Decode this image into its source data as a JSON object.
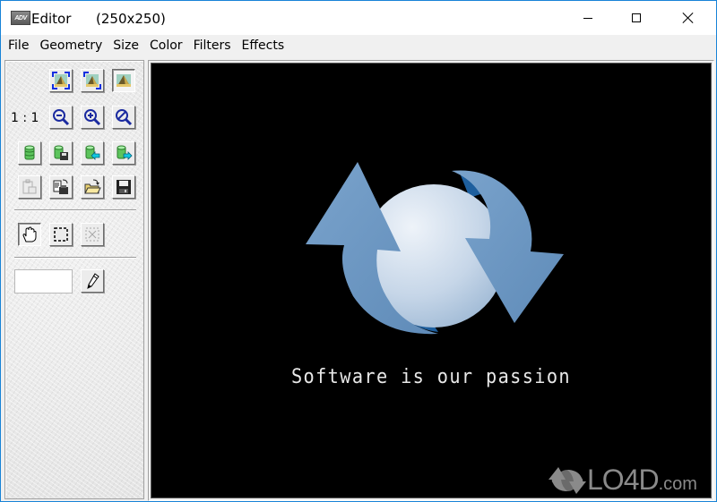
{
  "window": {
    "app_icon_label": "ADV",
    "title": "Editor",
    "image_size": "(250x250)",
    "controls": {
      "minimize": "minimize",
      "maximize": "maximize",
      "close": "close"
    }
  },
  "menubar": {
    "items": [
      {
        "label": "File"
      },
      {
        "label": "Geometry"
      },
      {
        "label": "Size"
      },
      {
        "label": "Color"
      },
      {
        "label": "Filters"
      },
      {
        "label": "Effects"
      }
    ]
  },
  "toolpanel": {
    "zoom_ratio_label": "1 : 1",
    "view_buttons": [
      {
        "icon": "fit-to-window-icon",
        "state": "normal"
      },
      {
        "icon": "fit-width-icon",
        "state": "normal"
      },
      {
        "icon": "actual-size-icon",
        "state": "pressed"
      }
    ],
    "zoom_buttons": [
      {
        "icon": "zoom-out-icon"
      },
      {
        "icon": "zoom-in-icon"
      },
      {
        "icon": "zoom-reset-icon"
      }
    ],
    "database_buttons": [
      {
        "icon": "database-icon"
      },
      {
        "icon": "database-save-icon"
      },
      {
        "icon": "database-import-icon"
      },
      {
        "icon": "database-export-icon"
      }
    ],
    "file_buttons": [
      {
        "icon": "paste-icon",
        "state": "disabled"
      },
      {
        "icon": "copy-to-clipboard-icon"
      },
      {
        "icon": "open-folder-icon"
      },
      {
        "icon": "save-icon"
      }
    ],
    "tool_buttons": [
      {
        "icon": "hand-pan-icon",
        "state": "pressed"
      },
      {
        "icon": "rectangle-select-icon"
      },
      {
        "icon": "crop-select-icon",
        "state": "disabled"
      }
    ],
    "color_field_value": "",
    "picker_icon": "pencil-icon"
  },
  "canvas": {
    "tagline": "Software is our passion",
    "colors": {
      "background": "#000000",
      "arrow": "#6f9ac4",
      "arrow_dark": "#1e5f9e",
      "sphere_light": "#e6eef6",
      "sphere_dark": "#a9c2dc"
    }
  },
  "watermark": {
    "brand": "LO4D",
    "suffix": ".com"
  }
}
